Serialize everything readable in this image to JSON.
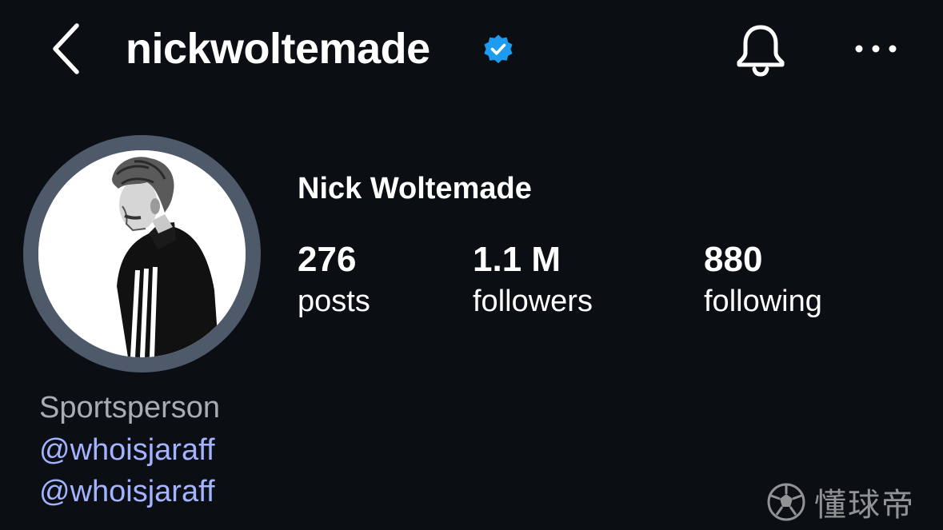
{
  "header": {
    "username": "nickwoltemade",
    "verified": true,
    "back_icon": "chevron-left-icon",
    "verified_icon": "verified-badge-icon",
    "bell_icon": "bell-icon",
    "more_icon": "more-horizontal-icon"
  },
  "profile": {
    "full_name": "Nick Woltemade",
    "avatar": "profile-photo"
  },
  "stats": [
    {
      "value": "276",
      "label": "posts"
    },
    {
      "value": "1.1 M",
      "label": "followers"
    },
    {
      "value": "880",
      "label": "following"
    }
  ],
  "bio": {
    "category": "Sportsperson",
    "links": [
      "@whoisjaraff",
      "@whoisjaraff"
    ]
  },
  "watermark": {
    "text": "懂球帝",
    "icon": "football-logo-icon"
  },
  "colors": {
    "background": "#0b0f14",
    "verified_blue": "#1d9bf0",
    "link": "#a3b3ff",
    "muted_text": "#a8adb5",
    "avatar_ring": "#4e5a69"
  }
}
